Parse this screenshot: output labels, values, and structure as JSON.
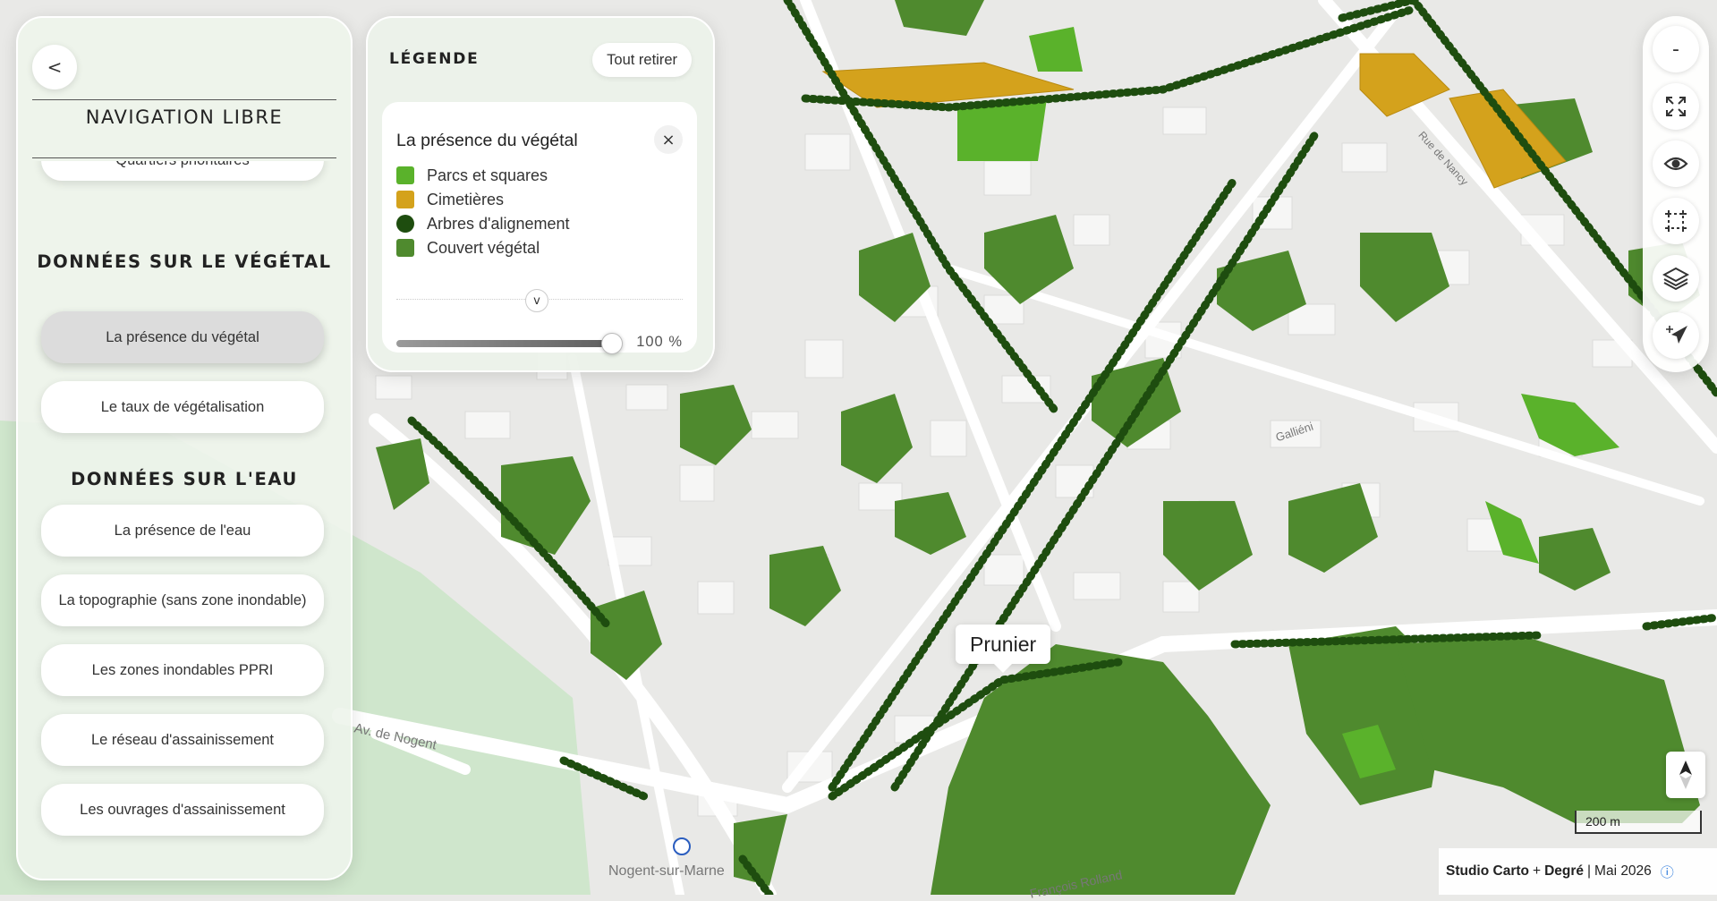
{
  "map": {
    "colors": {
      "background": "#e9e9e7",
      "building": "#f6f6f5",
      "road": "#ffffff",
      "vegetation": "#4f8a2e",
      "park": "#5ab22b",
      "cemetery": "#d4a21c",
      "tree": "#1e4d0f",
      "water": "#c8e6c7"
    },
    "tooltip": "Prunier",
    "streets": [
      "Av. de Nogent",
      "Nogent-sur-Marne",
      "Rue de Nancy",
      "Galliéni",
      "François Rolland"
    ],
    "rer_icon": "rer-station-icon"
  },
  "sidebar": {
    "back_label": "<",
    "title": "NAVIGATION LIBRE",
    "partial_item": "Quartiers prioritaires",
    "sections": [
      {
        "title": "DONNÉES SUR LE VÉGÉTAL",
        "items": [
          "La présence du végétal",
          "Le taux de végétalisation"
        ]
      },
      {
        "title": "DONNÉES SUR L'EAU",
        "items": [
          "La présence de l'eau",
          "La topographie (sans zone inondable)",
          "Les zones inondables PPRI",
          "Le réseau d'assainissement",
          "Les ouvrages d'assainissement"
        ]
      }
    ],
    "active_item": "La présence du végétal"
  },
  "legend": {
    "title": "LÉGENDE",
    "remove_all": "Tout retirer",
    "layer_title": "La présence du végétal",
    "close_label": "×",
    "entries": [
      {
        "label": "Parcs et squares",
        "color": "#5ab22b",
        "shape": "square"
      },
      {
        "label": "Cimetières",
        "color": "#d4a21c",
        "shape": "square"
      },
      {
        "label": "Arbres d'alignement",
        "color": "#1e4d0f",
        "shape": "circle"
      },
      {
        "label": "Couvert végétal",
        "color": "#4f8a2e",
        "shape": "square"
      }
    ],
    "expand_label": "v",
    "opacity_value": "100 %",
    "opacity_fraction": 1.0
  },
  "toolbar": {
    "zoom_out": "-",
    "icons": [
      "fullscreen-icon",
      "eye-icon",
      "selection-icon",
      "layers-icon",
      "navigate-icon"
    ]
  },
  "scale": {
    "label": "200 m"
  },
  "credits": {
    "studio": "Studio Carto",
    "plus": "+",
    "partner": "Degré",
    "date": "Mai 2026",
    "info": "ⓘ"
  }
}
